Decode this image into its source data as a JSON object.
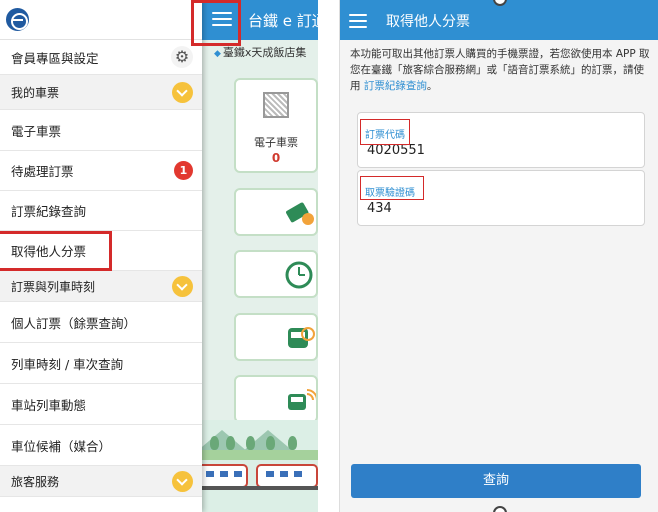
{
  "left_screen": {
    "app": {
      "title": "台鐵 e 訂通",
      "banner": "臺鐵x天成飯店集",
      "ticket_card": {
        "label": "電子車票",
        "count": "0"
      }
    },
    "drawer": {
      "items": [
        {
          "label": "會員專區與設定",
          "type": "item",
          "icon": "gear-icon"
        },
        {
          "label": "我的車票",
          "type": "section"
        },
        {
          "label": "電子車票",
          "type": "item"
        },
        {
          "label": "待處理訂票",
          "type": "item",
          "badge": "1"
        },
        {
          "label": "訂票紀錄查詢",
          "type": "item"
        },
        {
          "label": "取得他人分票",
          "type": "item",
          "highlighted": true
        },
        {
          "label": "訂票與列車時刻",
          "type": "section"
        },
        {
          "label": "個人訂票（餘票查詢）",
          "type": "item"
        },
        {
          "label": "列車時刻 / 車次查詢",
          "type": "item"
        },
        {
          "label": "車站列車動態",
          "type": "item"
        },
        {
          "label": "車位候補（媒合）",
          "type": "item"
        },
        {
          "label": "旅客服務",
          "type": "section"
        }
      ]
    }
  },
  "right_screen": {
    "title": "取得他人分票",
    "intro_text": "本功能可取出其他訂票人購買的手機票證，若您欲使用本 APP 取您在臺鐵「旅客綜合服務網」或「語音訂票系統」的訂票，請使用 ",
    "intro_link": "訂票紀錄查詢",
    "intro_end": "。",
    "fields": {
      "order_code": {
        "label": "訂票代碼",
        "value": "4020551"
      },
      "verify_code": {
        "label": "取票驗證碼",
        "value": "434"
      }
    },
    "query_button": "查詢"
  },
  "colors": {
    "header_blue": "#2f8fd2",
    "highlight_red": "#d42a2a",
    "chevron_yellow": "#f6c23c",
    "badge_red": "#e2382f"
  }
}
